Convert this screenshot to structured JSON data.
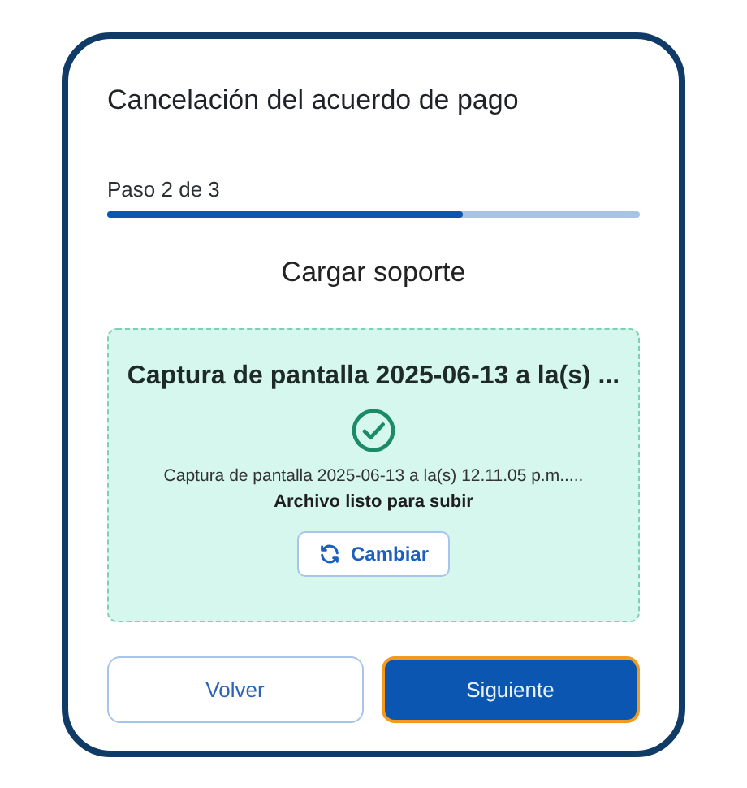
{
  "dialog": {
    "title": "Cancelación del acuerdo de pago"
  },
  "progress": {
    "label": "Paso 2 de 3",
    "level": 0.667
  },
  "section_title": "Cargar soporte",
  "upload": {
    "file_title": "Captura de pantalla 2025-06-13 a la(s) ...",
    "file_name": "Captura de pantalla 2025-06-13 a la(s) 12.11.05 p.m.....",
    "status": "Archivo listo para subir",
    "ready": true,
    "change_button": "Cambiar"
  },
  "buttons": [
    {
      "label": "Volver",
      "kind": "secondary",
      "focused": false
    },
    {
      "label": "Siguiente",
      "kind": "primary",
      "focused": true
    }
  ]
}
